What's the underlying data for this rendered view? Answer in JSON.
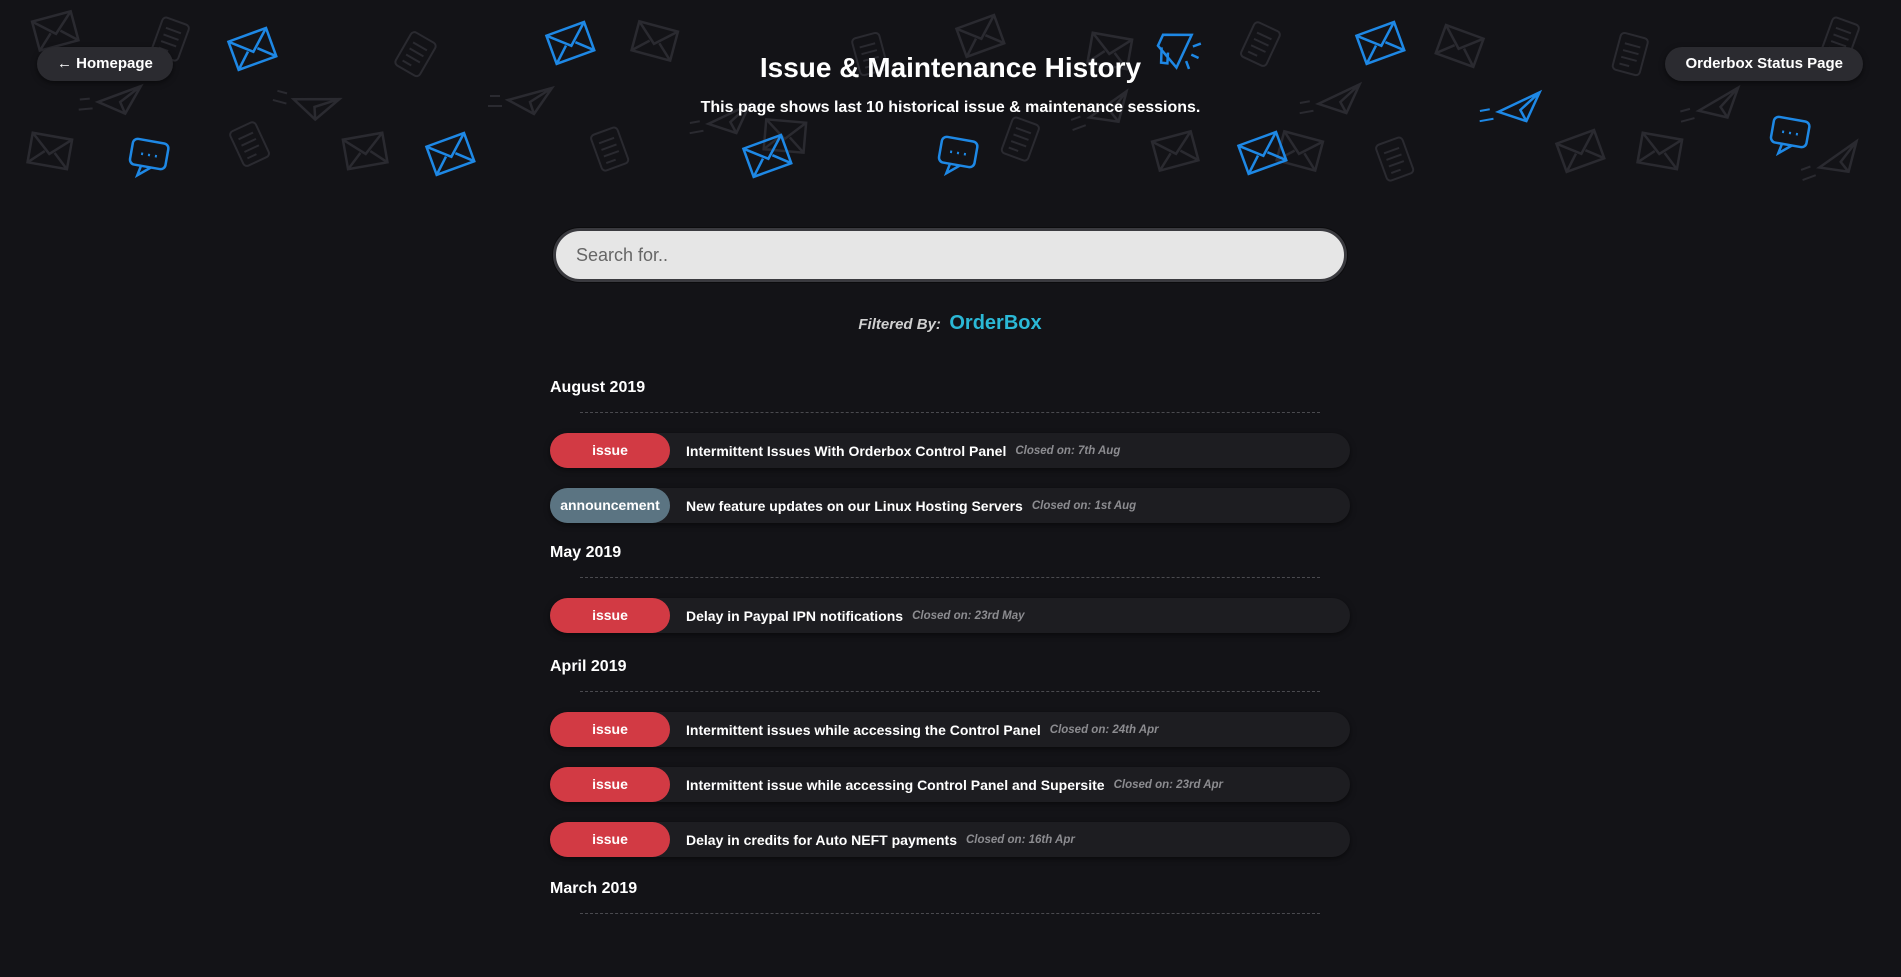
{
  "header": {
    "home_button": "← Homepage",
    "status_button": "Orderbox Status Page",
    "title": "Issue & Maintenance History",
    "subtitle": "This page shows last 10 historical issue & maintenance sessions."
  },
  "search": {
    "placeholder": "Search for..",
    "value": ""
  },
  "filter": {
    "label": "Filtered By:",
    "value": "OrderBox"
  },
  "history": [
    {
      "month": "August 2019",
      "items": [
        {
          "type": "issue",
          "title": "Intermittent Issues With Orderbox Control Panel",
          "closed": "Closed on: 7th Aug"
        },
        {
          "type": "announcement",
          "title": "New feature updates on our Linux Hosting Servers",
          "closed": "Closed on: 1st Aug"
        }
      ]
    },
    {
      "month": "May 2019",
      "items": [
        {
          "type": "issue",
          "title": "Delay in Paypal IPN notifications",
          "closed": "Closed on: 23rd May"
        }
      ]
    },
    {
      "month": "April 2019",
      "items": [
        {
          "type": "issue",
          "title": "Intermittent issues while accessing the Control Panel",
          "closed": "Closed on: 24th Apr"
        },
        {
          "type": "issue",
          "title": "Intermittent issue while accessing Control Panel and Supersite",
          "closed": "Closed on: 23rd Apr"
        },
        {
          "type": "issue",
          "title": "Delay in credits for Auto NEFT payments",
          "closed": "Closed on: 16th Apr"
        }
      ]
    },
    {
      "month": "March 2019",
      "items": []
    }
  ],
  "colors": {
    "background": "#131317",
    "issue_badge": "#d23a44",
    "announcement_badge": "#5b7482",
    "accent": "#2bb8d6",
    "icon_blue": "#1e88e5"
  },
  "icons": [
    "envelope-icon",
    "chat-bubble-icon",
    "megaphone-icon",
    "paper-plane-icon",
    "scroll-icon"
  ]
}
